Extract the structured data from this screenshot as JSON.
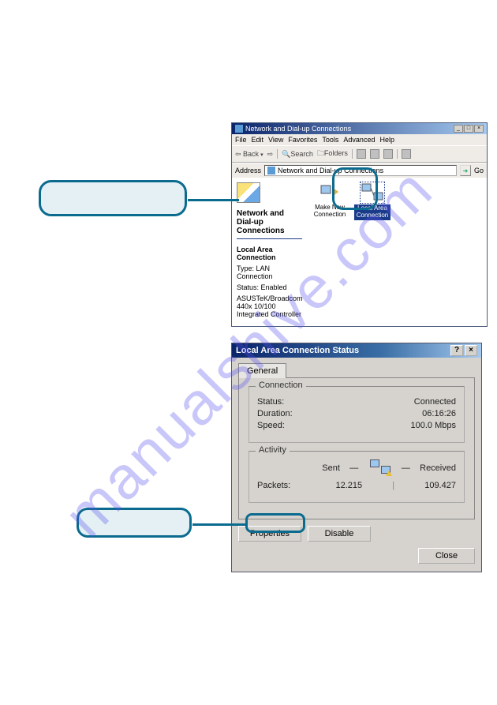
{
  "watermark": "manualshive.com",
  "win1": {
    "title": "Network and Dial-up Connections",
    "menu": [
      "File",
      "Edit",
      "View",
      "Favorites",
      "Tools",
      "Advanced",
      "Help"
    ],
    "toolbar": {
      "back": "Back",
      "search": "Search",
      "folders": "Folders"
    },
    "address_label": "Address",
    "address_value": "Network and Dial-up Connections",
    "go_label": "Go",
    "left_heading": "Network and Dial-up Connections",
    "sel_name": "Local Area Connection",
    "type_label": "Type: LAN Connection",
    "status_label": "Status: Enabled",
    "adapter": "ASUSTeK/Broadcom 440x 10/100 Integrated Controller",
    "icons": {
      "make_new": "Make New Connection",
      "lan": "Local Area Connection"
    }
  },
  "win2": {
    "title": "Local Area Connection Status",
    "tab_general": "General",
    "group_connection": "Connection",
    "status": {
      "label": "Status:",
      "value": "Connected"
    },
    "duration": {
      "label": "Duration:",
      "value": "06:16:26"
    },
    "speed": {
      "label": "Speed:",
      "value": "100.0 Mbps"
    },
    "group_activity": "Activity",
    "sent": "Sent",
    "received": "Received",
    "packets": {
      "label": "Packets:",
      "sent": "12.215",
      "received": "109.427"
    },
    "btn_properties": "Properties",
    "btn_disable": "Disable",
    "btn_close": "Close"
  }
}
